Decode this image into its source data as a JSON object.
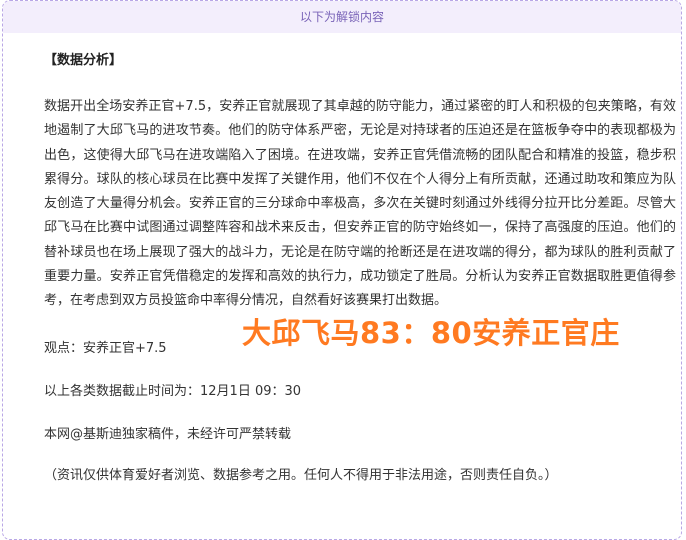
{
  "header": {
    "unlock_label": "以下为解锁内容"
  },
  "article": {
    "section_title": "【数据分析】",
    "analysis": "数据开出全场安养正官+7.5，安养正官就展现了其卓越的防守能力，通过紧密的盯人和积极的包夹策略，有效地遏制了大邱飞马的进攻节奏。他们的防守体系严密，无论是对持球者的压迫还是在篮板争夺中的表现都极为出色，这使得大邱飞马在进攻端陷入了困境。在进攻端，安养正官凭借流畅的团队配合和精准的投篮，稳步积累得分。球队的核心球员在比赛中发挥了关键作用，他们不仅在个人得分上有所贡献，还通过助攻和策应为队友创造了大量得分机会。安养正官的三分球命中率极高，多次在关键时刻通过外线得分拉开比分差距。尽管大邱飞马在比赛中试图通过调整阵容和战术来反击，但安养正官的防守始终如一，保持了高强度的压迫。他们的替补球员也在场上展现了强大的战斗力，无论是在防守端的抢断还是在进攻端的得分，都为球队的胜利贡献了重要力量。安养正官凭借稳定的发挥和高效的执行力，成功锁定了胜局。分析认为安养正官数据取胜更值得参考，在考虑到双方员投篮命中率得分情况，自然看好该赛果打出数据。",
    "viewpoint": "观点：安养正官+7.5",
    "cutoff_time": "以上各类数据截止时间为：12月1日 09：30",
    "copyright": "本网@基斯迪独家稿件，未经许可严禁转载",
    "disclaimer": "（资讯仅供体育爱好者浏览、数据参考之用。任何人不得用于非法用途，否则责任自负。）"
  },
  "score_overlay": {
    "text": "大邱飞马83：80安养正官庄",
    "color": "#ff7a21"
  }
}
